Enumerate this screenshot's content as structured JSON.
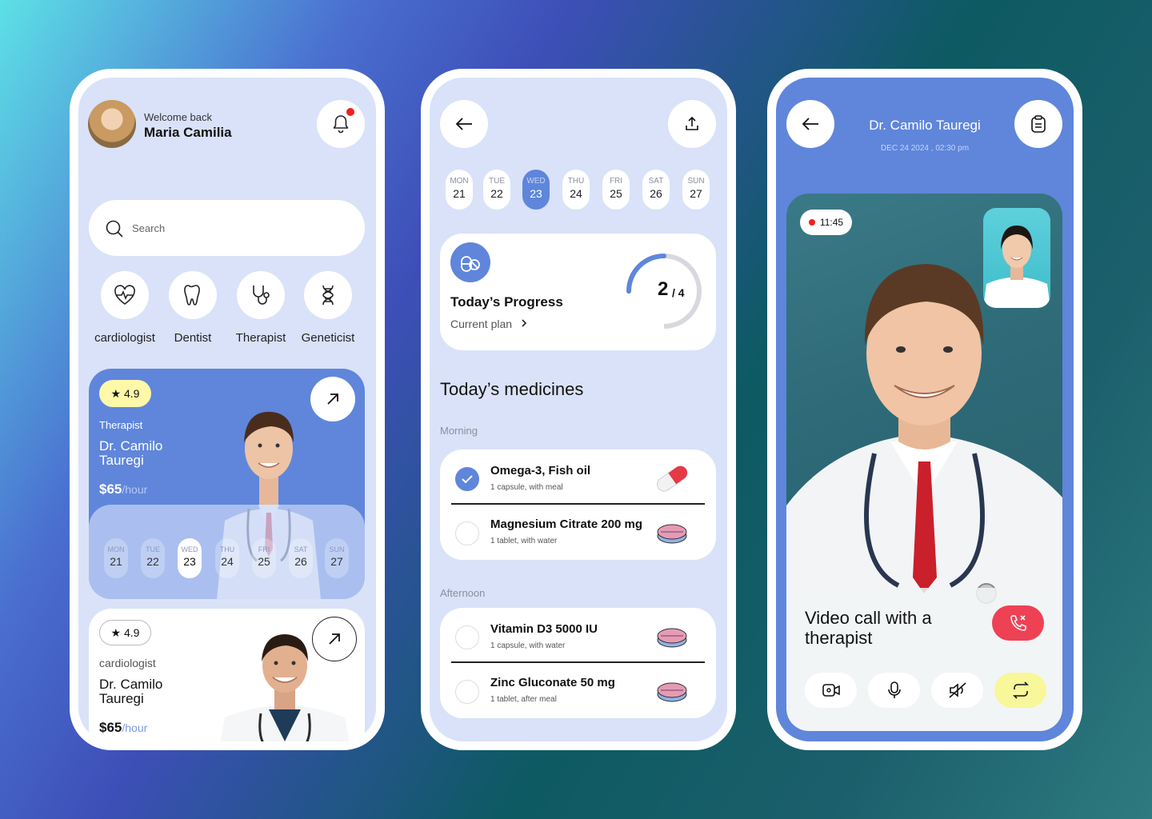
{
  "home": {
    "welcome": "Welcome back",
    "user_name": "Maria Camilia",
    "search_placeholder": "Search",
    "categories": [
      {
        "label": "cardiologist",
        "icon": "heart-pulse-icon"
      },
      {
        "label": "Dentist",
        "icon": "tooth-icon"
      },
      {
        "label": "Therapist",
        "icon": "stethoscope-icon"
      },
      {
        "label": "Geneticist",
        "icon": "dna-icon"
      }
    ],
    "featured": {
      "rating": "★ 4.9",
      "role": "Therapist",
      "name": "Dr. Camilo Tauregi",
      "price": "$65",
      "price_unit": "/hour",
      "days": [
        {
          "day": "MON",
          "num": "21"
        },
        {
          "day": "TUE",
          "num": "22"
        },
        {
          "day": "WED",
          "num": "23"
        },
        {
          "day": "THU",
          "num": "24"
        },
        {
          "day": "FRI",
          "num": "25"
        },
        {
          "day": "SAT",
          "num": "26"
        },
        {
          "day": "SUN",
          "num": "27"
        }
      ]
    },
    "second": {
      "rating": "★ 4.9",
      "role": "cardiologist",
      "name": "Dr. Camilo Tauregi",
      "price": "$65",
      "price_unit": "/hour"
    }
  },
  "plan": {
    "days": [
      {
        "day": "MON",
        "num": "21"
      },
      {
        "day": "TUE",
        "num": "22"
      },
      {
        "day": "WED",
        "num": "23"
      },
      {
        "day": "THU",
        "num": "24"
      },
      {
        "day": "FRI",
        "num": "25"
      },
      {
        "day": "SAT",
        "num": "26"
      },
      {
        "day": "SUN",
        "num": "27"
      }
    ],
    "selected_day": "WED",
    "progress_title": "Today’s Progress",
    "progress_sub": "Current plan",
    "progress_done": "2",
    "progress_total": "/ 4",
    "progress_fraction": 0.5,
    "section_title": "Today’s medicines",
    "morning_label": "Morning",
    "afternoon_label": "Afternoon",
    "morning": [
      {
        "name": "Omega-3, Fish oil",
        "note": "1 capsule, with meal",
        "done": true,
        "pic": "capsule-icon"
      },
      {
        "name": "Magnesium Citrate 200 mg",
        "note": "1 tablet, with water",
        "done": false,
        "pic": "tablet-icon"
      }
    ],
    "afternoon": [
      {
        "name": "Vitamin D3 5000 IU",
        "note": "1 capsule, with water",
        "done": false,
        "pic": "tablet-icon"
      },
      {
        "name": "Zinc Gluconate 50 mg",
        "note": "1 tablet, after meal",
        "done": false,
        "pic": "tablet-icon"
      }
    ]
  },
  "call": {
    "doctor_name": "Dr. Camilo Tauregi",
    "date": "DEC 24 2024 , 02:30 pm",
    "timer": "11:45",
    "title": "Video call with a therapist"
  },
  "colors": {
    "accent": "#5f86db",
    "screen_bg": "#d9e2f8",
    "rating_yellow": "#fff8a8",
    "end_call": "#ee4154",
    "alert": "#f01f1f"
  }
}
